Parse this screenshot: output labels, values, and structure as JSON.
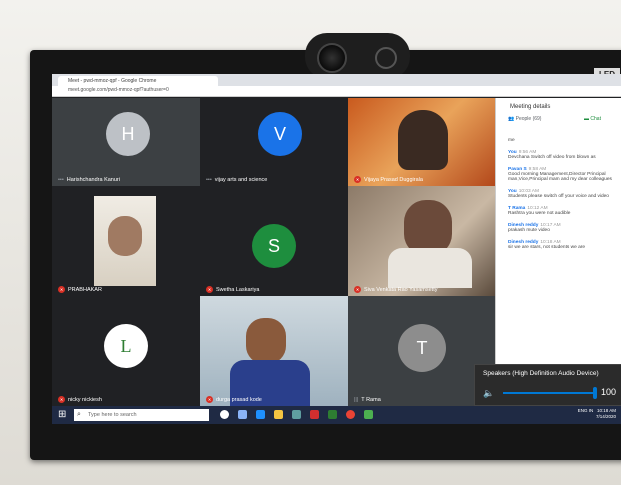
{
  "browser": {
    "tab_title": "Meet - pwd-mmoz-qpf - Google Chrome",
    "url": "meet.google.com/pwd-mmoz-qpf?authuser=0"
  },
  "device": {
    "led_label": "LED"
  },
  "tiles": [
    {
      "initial": "H",
      "name": "Harishchandra Kanuri",
      "avatar_color": "#bdc1c6"
    },
    {
      "initial": "V",
      "name": "vijay arts and science",
      "avatar_color": "#1a73e8"
    },
    {
      "name": "Vijaya Prasad Duggirala"
    },
    {
      "name": "PRABHAKAR"
    },
    {
      "initial": "S",
      "name": "Swetha Laskariya",
      "avatar_color": "#1e8e3e"
    },
    {
      "name": "Siva Venkata Rao Yasamsetty"
    },
    {
      "initial": "L",
      "name": "nicky nickiesh",
      "avatar_color": "#ffffff"
    },
    {
      "name": "durga prasad kode"
    },
    {
      "initial": "T",
      "name": "T Rama",
      "avatar_color": "#8d8d8d"
    }
  ],
  "panel": {
    "title": "Meeting details",
    "people_tab": "People (69)",
    "chat_tab": "Chat",
    "top_text": "me",
    "messages": [
      {
        "sender": "You",
        "time": "9:56 AM",
        "text": "Devchana Switch off video from blown as"
      },
      {
        "sender": "Pavan S",
        "time": "9:58 AM",
        "text": "Good morning Management,Director Principal man,Vice,Principal mam and my dear colleagues"
      },
      {
        "sender": "You",
        "time": "10:03 AM",
        "text": "Students please switch off your voice and video"
      },
      {
        "sender": "T Rama",
        "time": "10:12 AM",
        "text": "Rashtra you were not audible"
      },
      {
        "sender": "Dinesh reddy",
        "time": "10:17 AM",
        "text": "prakash mute video"
      },
      {
        "sender": "Dinesh reddy",
        "time": "10:18 AM",
        "text": "sir we are stars, not students we are"
      }
    ]
  },
  "volume_popup": {
    "title": "Speakers (High Definition Audio Device)",
    "value": "100",
    "level": 1.0
  },
  "taskbar": {
    "search_placeholder": "Type here to search",
    "lang": "ENG",
    "region": "IN",
    "time": "10:18 AM",
    "date": "7/14/2020"
  }
}
